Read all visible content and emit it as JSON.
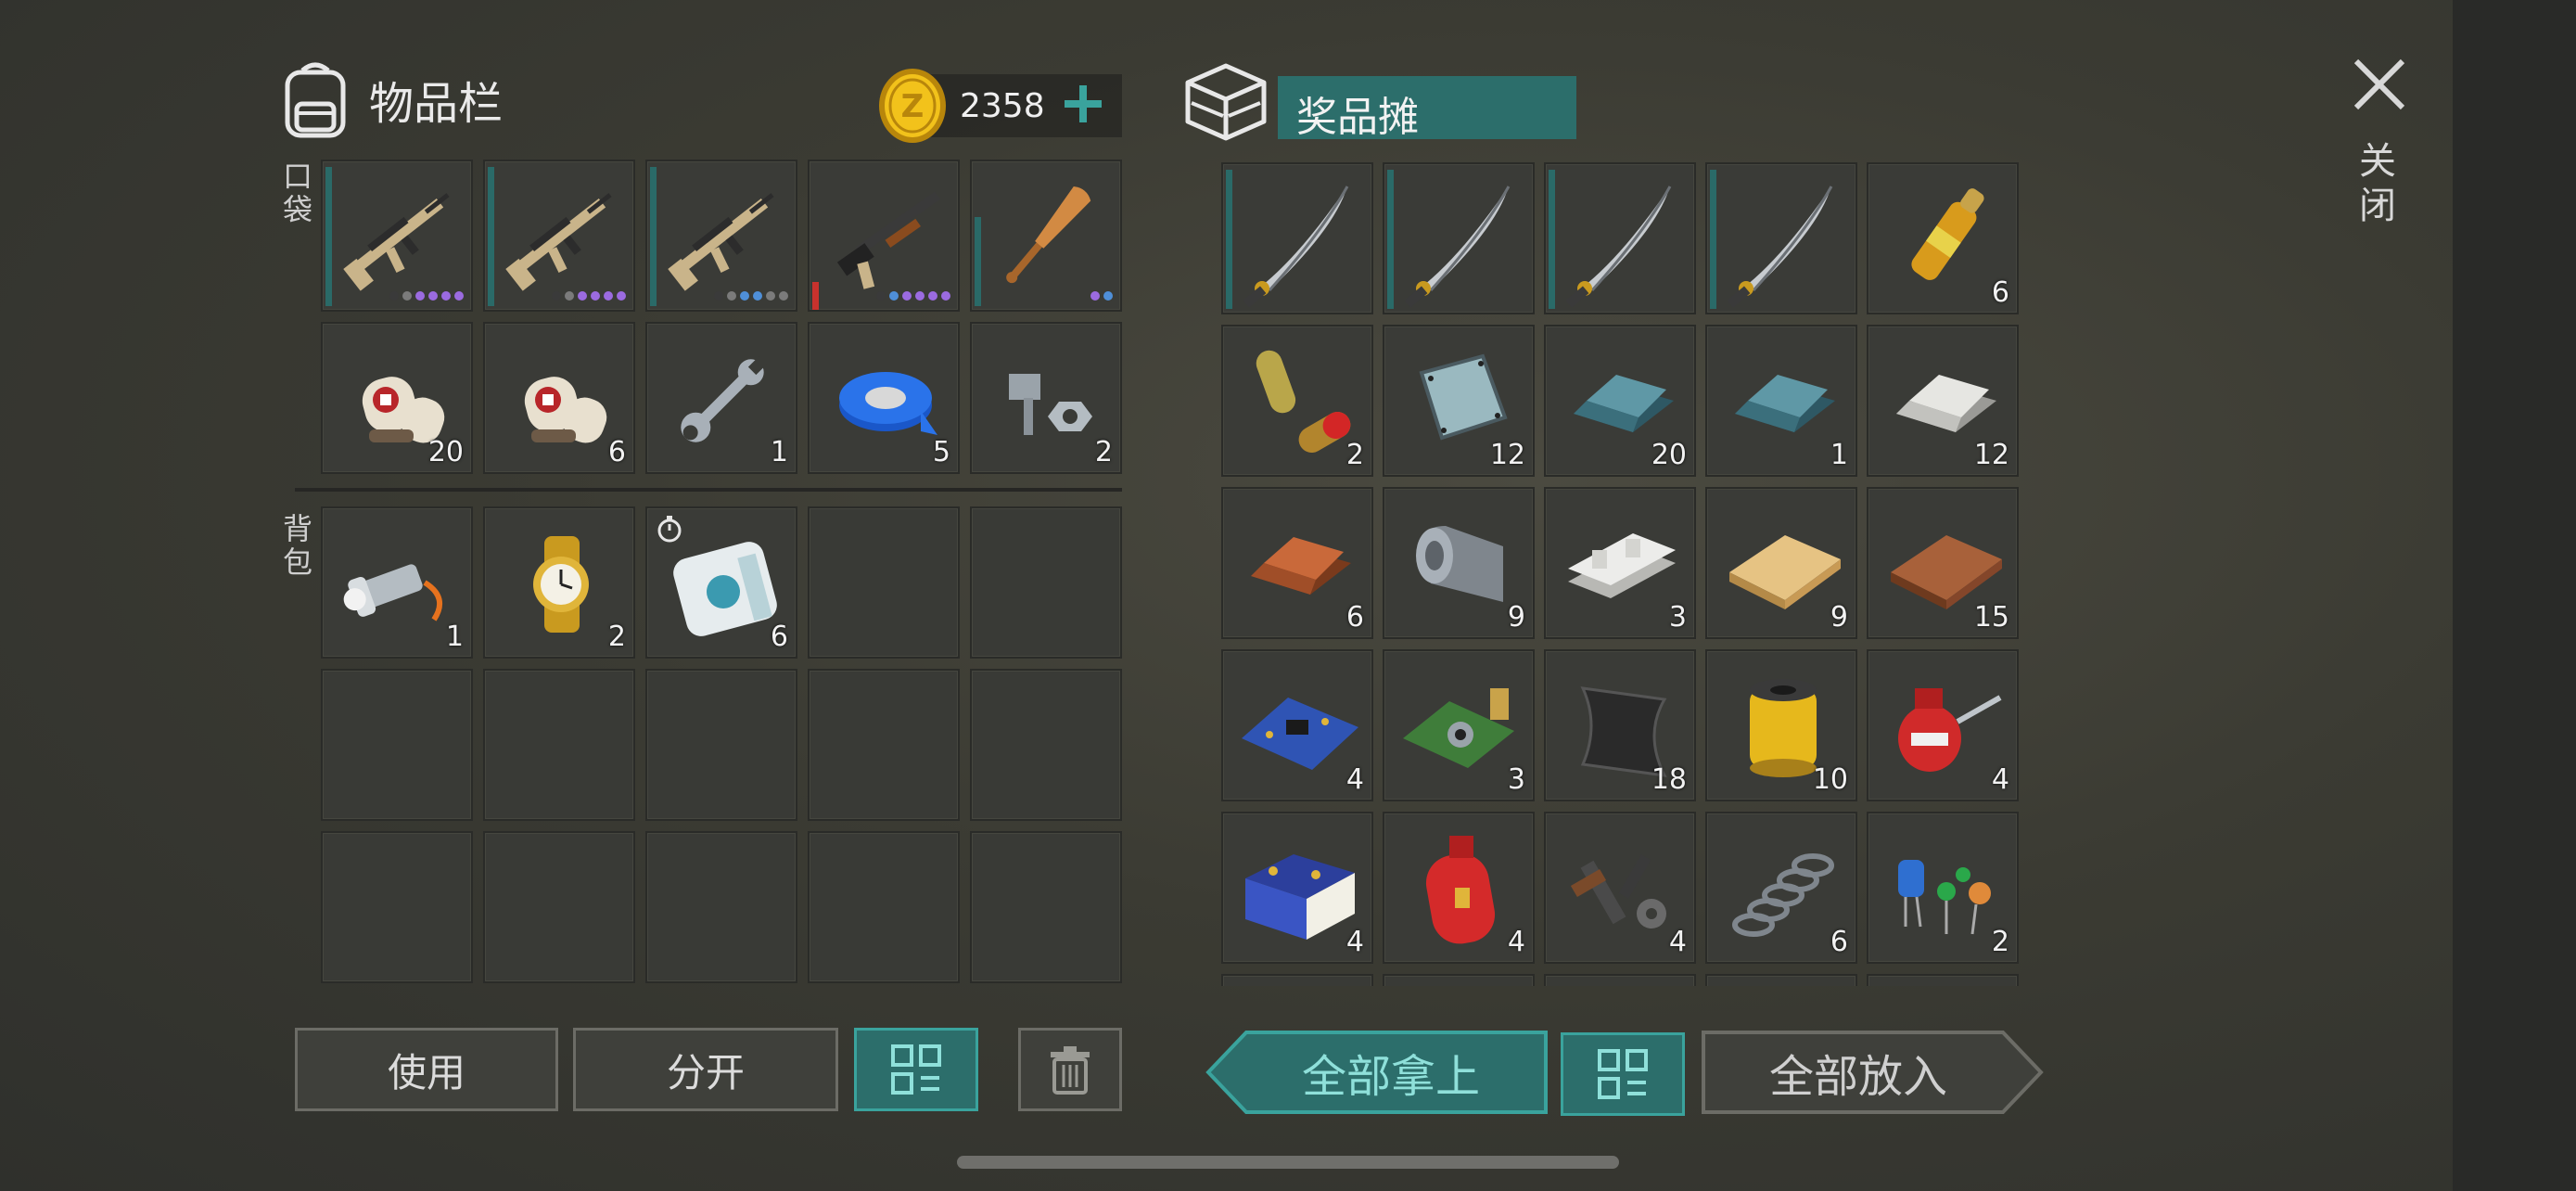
{
  "inventory": {
    "title": "物品栏",
    "coins": "2358",
    "pocket_label": "口袋",
    "backpack_label": "背包",
    "pocket_slots": [
      {
        "item": "assault-rifle-icon",
        "qty": "",
        "bar": "full",
        "dots": [
          "#3a3a3a",
          "#7b7b7b",
          "#9b6be0",
          "#9b6be0",
          "#9b6be0",
          "#9b6be0"
        ]
      },
      {
        "item": "assault-rifle-icon",
        "qty": "",
        "bar": "full",
        "dots": [
          "#3a3a3a",
          "#7b7b7b",
          "#9b6be0",
          "#9b6be0",
          "#9b6be0",
          "#9b6be0"
        ]
      },
      {
        "item": "assault-rifle-icon",
        "qty": "",
        "bar": "full",
        "dots": [
          "#3a3a3a",
          "#7b7b7b",
          "#4f8fd8",
          "#4f8fd8",
          "#7b7b7b",
          "#7b7b7b"
        ]
      },
      {
        "item": "shotgun-icon",
        "qty": "",
        "bar": "red",
        "dots": [
          "#3a3a3a",
          "#4f8fd8",
          "#9b6be0",
          "#9b6be0",
          "#9b6be0",
          "#9b6be0"
        ]
      },
      {
        "item": "baseball-bat-icon",
        "qty": "",
        "bar": "short",
        "dots": [
          "#9b6be0",
          "#4f8fd8"
        ]
      },
      {
        "item": "bandage-icon",
        "qty": "20"
      },
      {
        "item": "bandage-icon",
        "qty": "6"
      },
      {
        "item": "wrench-icon",
        "qty": "1"
      },
      {
        "item": "duct-tape-icon",
        "qty": "5"
      },
      {
        "item": "bolt-nut-icon",
        "qty": "2"
      }
    ],
    "backpack_slots": [
      {
        "item": "flashlight-icon",
        "qty": "1"
      },
      {
        "item": "wristwatch-icon",
        "qty": "2"
      },
      {
        "item": "food-pack-icon",
        "qty": "6",
        "timer": true
      },
      {},
      {},
      {},
      {},
      {},
      {},
      {},
      {},
      {},
      {},
      {},
      {}
    ]
  },
  "stall": {
    "title": "奖品摊",
    "slots": [
      {
        "item": "katana-icon",
        "qty": "",
        "bar": "full"
      },
      {
        "item": "katana-icon",
        "qty": "",
        "bar": "full"
      },
      {
        "item": "katana-icon",
        "qty": "",
        "bar": "full"
      },
      {
        "item": "katana-icon",
        "qty": "",
        "bar": "full"
      },
      {
        "item": "ampoule-icon",
        "qty": "6"
      },
      {
        "item": "pills-icon",
        "qty": "2"
      },
      {
        "item": "glass-plate-icon",
        "qty": "12"
      },
      {
        "item": "steel-ingot-icon",
        "qty": "20"
      },
      {
        "item": "steel-ingot-icon",
        "qty": "1"
      },
      {
        "item": "silver-ingot-icon",
        "qty": "12"
      },
      {
        "item": "copper-ingot-icon",
        "qty": "6"
      },
      {
        "item": "metal-sheet-roll-icon",
        "qty": "9"
      },
      {
        "item": "aluminum-bar-icon",
        "qty": "3"
      },
      {
        "item": "wood-plank-icon",
        "qty": "9"
      },
      {
        "item": "hardwood-plank-icon",
        "qty": "15"
      },
      {
        "item": "circuit-board-icon",
        "qty": "4"
      },
      {
        "item": "sensor-board-icon",
        "qty": "3"
      },
      {
        "item": "carbon-fabric-icon",
        "qty": "18"
      },
      {
        "item": "oil-filter-icon",
        "qty": "10"
      },
      {
        "item": "oil-can-icon",
        "qty": "4"
      },
      {
        "item": "car-battery-icon",
        "qty": "4"
      },
      {
        "item": "gas-cylinder-icon",
        "qty": "4"
      },
      {
        "item": "gun-parts-icon",
        "qty": "4"
      },
      {
        "item": "spring-icon",
        "qty": "6"
      },
      {
        "item": "capacitors-icon",
        "qty": "2"
      },
      {
        "item": "",
        "qty": ""
      },
      {
        "item": "",
        "qty": ""
      },
      {
        "item": "",
        "qty": ""
      },
      {
        "item": "",
        "qty": ""
      },
      {
        "item": "",
        "qty": ""
      }
    ]
  },
  "buttons": {
    "use": "使用",
    "split": "分开",
    "take_all": "全部拿上",
    "put_all": "全部放入"
  },
  "close_label": "关闭",
  "colors": {
    "accent_teal": "#2c6e6b",
    "teal_border": "#3aa39d",
    "slot_bg": "#3a3b37",
    "durability_bar": "#2a6a68"
  }
}
